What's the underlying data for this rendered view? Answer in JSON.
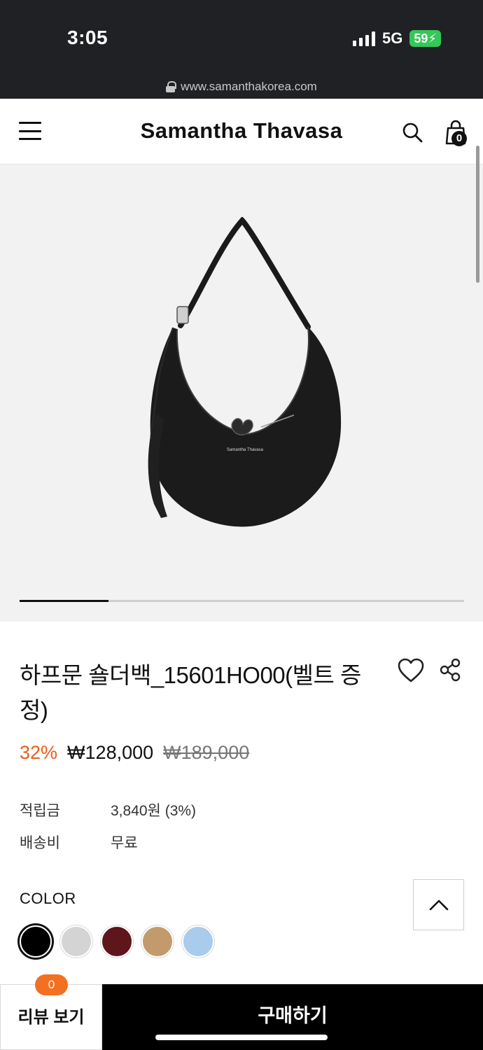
{
  "status_bar": {
    "time": "3:05",
    "network": "5G",
    "battery": "59"
  },
  "browser": {
    "url": "www.samanthakorea.com"
  },
  "header": {
    "brand": "Samantha Thavasa",
    "cart_count": "0"
  },
  "gallery": {
    "image_progress": 0.2,
    "bag_logo_text": "Samantha Thavasa"
  },
  "product": {
    "title": "하프문 숄더백_15601HO00(벨트 증정)",
    "discount": "32%",
    "price": "₩128,000",
    "original_price": "₩189,000"
  },
  "info": {
    "points_label": "적립금",
    "points_value": "3,840원 (3%)",
    "shipping_label": "배송비",
    "shipping_value": "무료"
  },
  "colors": {
    "label": "COLOR",
    "swatches": [
      "#000000",
      "#d4d4d4",
      "#5e151c",
      "#c39a6b",
      "#a9cbec"
    ]
  },
  "bottom_bar": {
    "review_label": "리뷰 보기",
    "review_count": "0",
    "buy_label": "구매하기"
  },
  "accent": {
    "discount_color": "#ec5b18",
    "badge_color": "#f37021"
  }
}
